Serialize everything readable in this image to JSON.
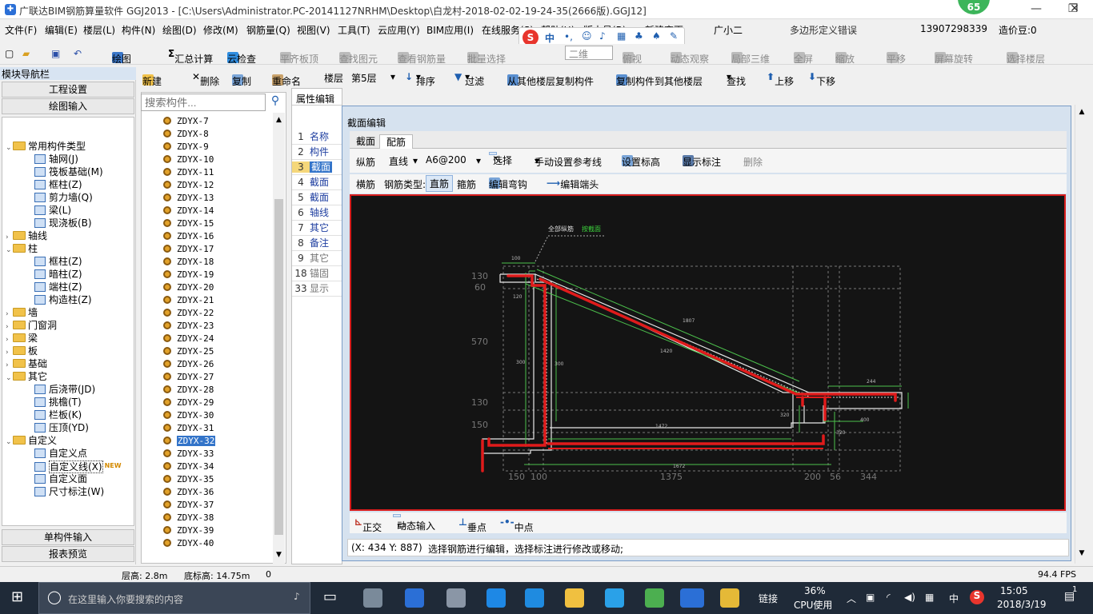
{
  "window": {
    "title": "广联达BIM钢筋算量软件 GGJ2013 - [C:\\Users\\Administrator.PC-20141127NRHM\\Desktop\\白龙村-2018-02-02-19-24-35(2666版).GGJ12]",
    "badge": "65",
    "minimize": "—",
    "maximize": "❐",
    "close": "✕"
  },
  "menubar": {
    "items": [
      "文件(F)",
      "编辑(E)",
      "楼层(L)",
      "构件(N)",
      "绘图(D)",
      "修改(M)",
      "钢筋量(Q)",
      "视图(V)",
      "工具(T)",
      "云应用(Y)",
      "BIM应用(I)",
      "在线服务(S)",
      "帮助(H)",
      "版本号(B)",
      "新建变更",
      "广小二"
    ],
    "error_text": "多边形定义错误",
    "phone": "13907298339",
    "price": "造价豆:0"
  },
  "toolbar1": {
    "draw": "绘图",
    "sum": "汇总计算",
    "cloud_check": "云检查",
    "flat_top": "平齐板顶",
    "find_elem": "查找图元",
    "view_rebar": "查看钢筋量",
    "batch_select": "批量选择",
    "view_mode": "二维",
    "top_view": "俯视",
    "dyn_observe": "动态观察",
    "local_3d": "局部三维",
    "fullscreen": "全屏",
    "zoom": "缩放",
    "pan": "平移",
    "rotate": "屏幕旋转",
    "select_floor": "选择楼层"
  },
  "toolbar2": {
    "new": "新建",
    "delete": "删除",
    "copy": "复制",
    "rename": "重命名",
    "floor_label": "楼层",
    "floor_value": "第5层",
    "sort": "排序",
    "filter": "过滤",
    "copy_from": "从其他楼层复制构件",
    "copy_to": "复制构件到其他楼层",
    "find": "查找",
    "move_up": "上移",
    "move_down": "下移"
  },
  "leftnav": {
    "header": "模块导航栏",
    "btn_project": "工程设置",
    "btn_draw": "绘图输入",
    "btn_single": "单构件输入",
    "btn_report": "报表预览",
    "tree": [
      {
        "label": "常用构件类型",
        "level": 0,
        "kind": "folder",
        "open": true
      },
      {
        "label": "轴网(J)",
        "level": 1,
        "kind": "comp"
      },
      {
        "label": "筏板基础(M)",
        "level": 1,
        "kind": "comp"
      },
      {
        "label": "框柱(Z)",
        "level": 1,
        "kind": "comp"
      },
      {
        "label": "剪力墙(Q)",
        "level": 1,
        "kind": "comp"
      },
      {
        "label": "梁(L)",
        "level": 1,
        "kind": "comp"
      },
      {
        "label": "现浇板(B)",
        "level": 1,
        "kind": "comp"
      },
      {
        "label": "轴线",
        "level": 0,
        "kind": "folder",
        "open": false
      },
      {
        "label": "柱",
        "level": 0,
        "kind": "folder",
        "open": true
      },
      {
        "label": "框柱(Z)",
        "level": 1,
        "kind": "comp"
      },
      {
        "label": "暗柱(Z)",
        "level": 1,
        "kind": "comp"
      },
      {
        "label": "端柱(Z)",
        "level": 1,
        "kind": "comp"
      },
      {
        "label": "构造柱(Z)",
        "level": 1,
        "kind": "comp"
      },
      {
        "label": "墙",
        "level": 0,
        "kind": "folder",
        "open": false
      },
      {
        "label": "门窗洞",
        "level": 0,
        "kind": "folder",
        "open": false
      },
      {
        "label": "梁",
        "level": 0,
        "kind": "folder",
        "open": false
      },
      {
        "label": "板",
        "level": 0,
        "kind": "folder",
        "open": false
      },
      {
        "label": "基础",
        "level": 0,
        "kind": "folder",
        "open": false
      },
      {
        "label": "其它",
        "level": 0,
        "kind": "folder",
        "open": true
      },
      {
        "label": "后浇带(JD)",
        "level": 1,
        "kind": "comp"
      },
      {
        "label": "挑檐(T)",
        "level": 1,
        "kind": "comp"
      },
      {
        "label": "栏板(K)",
        "level": 1,
        "kind": "comp"
      },
      {
        "label": "压顶(YD)",
        "level": 1,
        "kind": "comp"
      },
      {
        "label": "自定义",
        "level": 0,
        "kind": "folder",
        "open": true
      },
      {
        "label": "自定义点",
        "level": 1,
        "kind": "comp"
      },
      {
        "label": "自定义线(X)",
        "level": 1,
        "kind": "comp",
        "selected": true
      },
      {
        "label": "自定义面",
        "level": 1,
        "kind": "comp"
      },
      {
        "label": "尺寸标注(W)",
        "level": 1,
        "kind": "comp"
      }
    ],
    "new_badge": "NEW"
  },
  "complist": {
    "search_placeholder": "搜索构件...",
    "items": [
      "ZDYX-7",
      "ZDYX-8",
      "ZDYX-9",
      "ZDYX-10",
      "ZDYX-11",
      "ZDYX-12",
      "ZDYX-13",
      "ZDYX-14",
      "ZDYX-15",
      "ZDYX-16",
      "ZDYX-17",
      "ZDYX-18",
      "ZDYX-19",
      "ZDYX-20",
      "ZDYX-21",
      "ZDYX-22",
      "ZDYX-23",
      "ZDYX-24",
      "ZDYX-25",
      "ZDYX-26",
      "ZDYX-27",
      "ZDYX-28",
      "ZDYX-29",
      "ZDYX-30",
      "ZDYX-31",
      "ZDYX-32",
      "ZDYX-33",
      "ZDYX-34",
      "ZDYX-35",
      "ZDYX-36",
      "ZDYX-37",
      "ZDYX-38",
      "ZDYX-39",
      "ZDYX-40"
    ],
    "selected": "ZDYX-32"
  },
  "props": {
    "tab": "属性编辑",
    "rows": [
      {
        "n": "1",
        "v": "名称"
      },
      {
        "n": "2",
        "v": "构件"
      },
      {
        "n": "3",
        "v": "截面"
      },
      {
        "n": "4",
        "v": "截面"
      },
      {
        "n": "5",
        "v": "截面"
      },
      {
        "n": "6",
        "v": "轴线"
      },
      {
        "n": "7",
        "v": "其它"
      },
      {
        "n": "8",
        "v": "备注"
      },
      {
        "n": "9",
        "v": "其它"
      },
      {
        "n": "18",
        "v": "锚固"
      },
      {
        "n": "33",
        "v": "显示"
      }
    ]
  },
  "dialog": {
    "title": "截面编辑",
    "tab1": "截面",
    "tab2": "配筋",
    "long_bar": "纵筋",
    "line_type": "直线",
    "spec": "A6@200",
    "select": "选择",
    "manual_ref": "手动设置参考线",
    "set_elev": "设置标高",
    "show_dim": "显示标注",
    "del": "删除",
    "trans_bar": "横筋",
    "bar_type": "钢筋类型:",
    "straight": "直筋",
    "stirrup": "箍筋",
    "edit_hook": "编辑弯钩",
    "edit_end": "编辑端头",
    "ortho": "正交",
    "dyn_input": "动态输入",
    "perp": "垂点",
    "mid": "中点",
    "coords": "(X: 434 Y: 887)",
    "hint": "选择钢筋进行编辑，选择标注进行修改或移动;",
    "cad": {
      "all_long": "全部纵筋",
      "by_section": "按截面",
      "dims_left": [
        "130",
        "60",
        "570",
        "130",
        "150"
      ],
      "dims_bottom": [
        "150",
        "100",
        "1375",
        "200",
        "56",
        "344"
      ],
      "small_labels": [
        "100",
        "120",
        "1807",
        "1420",
        "300",
        "300",
        "1472",
        "1672",
        "244",
        "400",
        "320",
        "320"
      ]
    }
  },
  "statusbar": {
    "floor_h": "层高: 2.8m",
    "base_elev": "底标高: 14.75m",
    "zero": "0",
    "fps": "94.4 FPS"
  },
  "taskbar": {
    "search": "在这里输入你要搜索的内容",
    "link": "链接",
    "cpu_pct": "36%",
    "cpu_label": "CPU使用",
    "ime": "中",
    "time": "15:05",
    "date": "2018/3/19",
    "notify": "1"
  }
}
